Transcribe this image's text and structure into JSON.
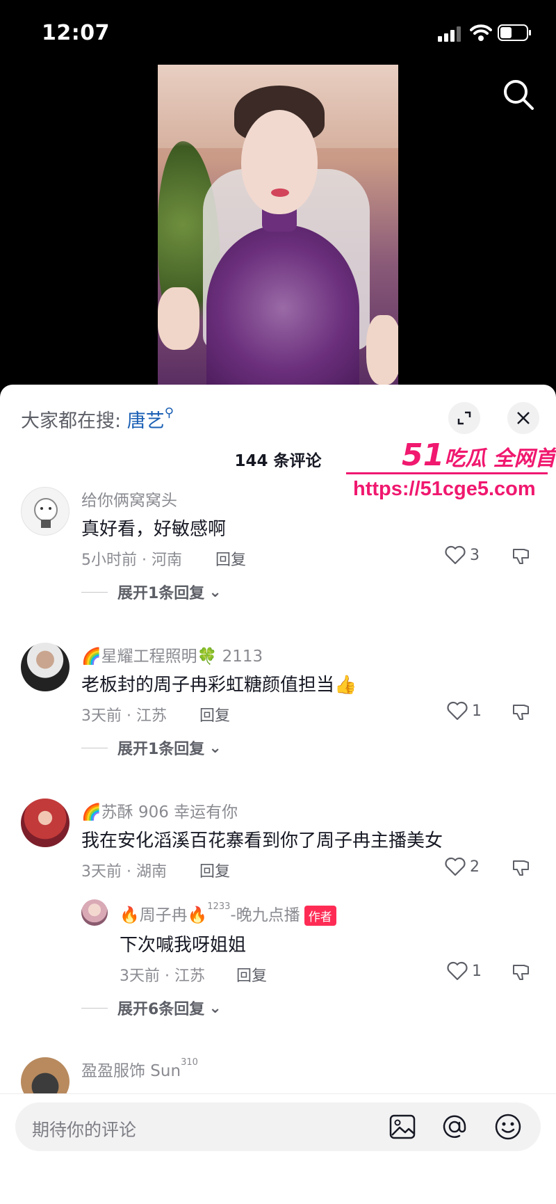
{
  "status_bar": {
    "time": "12:07"
  },
  "sheet": {
    "hot_search_label": "大家都在搜:",
    "hot_search_keyword": "唐艺",
    "comment_count": "144 条评论"
  },
  "watermark": {
    "brand_num": "51",
    "brand_text": "吃瓜 全网首发",
    "url": "https://51cge5.com"
  },
  "comments": [
    {
      "user": "给你俩窝窝头",
      "text": "真好看，好敏感啊",
      "time_loc": "5小时前 · 河南",
      "reply": "回复",
      "likes": "3",
      "expand": "展开1条回复"
    },
    {
      "user_prefix": "🌈",
      "user": "星耀工程照明",
      "user_suffix": "🍀 2113",
      "text": "老板封的周子冉彩虹糖颜值担当👍",
      "time_loc": "3天前 · 江苏",
      "reply": "回复",
      "likes": "1",
      "expand": "展开1条回复"
    },
    {
      "user_prefix": "🌈",
      "user": "苏酥 906 幸运有你",
      "text": "我在安化滔溪百花寨看到你了周子冉主播美女",
      "time_loc": "3天前 · 湖南",
      "reply": "回复",
      "likes": "2",
      "expand": "展开6条回复",
      "sub_reply": {
        "user_pre": "🔥",
        "user": "周子冉",
        "user_post": "🔥",
        "sup": "1233",
        "user_tail": "-晚九点播",
        "tag": "作者",
        "text": "下次喊我呀姐姐",
        "time_loc": "3天前 · 江苏",
        "reply": "回复",
        "likes": "1"
      }
    },
    {
      "user": "盈盈服饰 Sun",
      "user_sup": "310"
    }
  ],
  "input": {
    "placeholder": "期待你的评论"
  },
  "icons": [
    "search-icon",
    "expand-icon",
    "close-icon",
    "heart-icon",
    "dislike-icon",
    "image-icon",
    "at-icon",
    "emoji-icon",
    "chevron-down-icon"
  ],
  "colors": {
    "accent": "#fe2c55",
    "link": "#1a5fb4",
    "watermark": "#f0186f"
  }
}
